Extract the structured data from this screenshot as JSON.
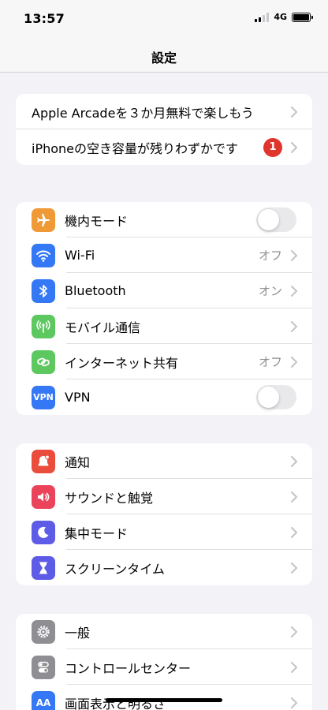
{
  "status_bar": {
    "time": "13:57",
    "network": "4G"
  },
  "nav": {
    "title": "設定"
  },
  "group1": [
    {
      "label": "Apple Arcadeを３か月無料で楽しもう"
    },
    {
      "label": "iPhoneの空き容量が残りわずかです",
      "badge": "1"
    }
  ],
  "group2": [
    {
      "label": "機内モード",
      "icon": "airplane-icon",
      "color": "#f09a37",
      "toggle": false
    },
    {
      "label": "Wi-Fi",
      "icon": "wifi-icon",
      "color": "#3478f6",
      "value": "オフ"
    },
    {
      "label": "Bluetooth",
      "icon": "bluetooth-icon",
      "color": "#3478f6",
      "value": "オン"
    },
    {
      "label": "モバイル通信",
      "icon": "antenna-icon",
      "color": "#5cc85f"
    },
    {
      "label": "インターネット共有",
      "icon": "link-icon",
      "color": "#5cc85f",
      "value": "オフ"
    },
    {
      "label": "VPN",
      "icon": "vpn-icon",
      "icon_text": "VPN",
      "color": "#3478f6",
      "toggle": false
    }
  ],
  "group3": [
    {
      "label": "通知",
      "icon": "bell-icon",
      "color": "#eb4d3d"
    },
    {
      "label": "サウンドと触覚",
      "icon": "speaker-icon",
      "color": "#eb445a"
    },
    {
      "label": "集中モード",
      "icon": "moon-icon",
      "color": "#5e5ce6"
    },
    {
      "label": "スクリーンタイム",
      "icon": "hourglass-icon",
      "color": "#5e5ce6"
    }
  ],
  "group4": [
    {
      "label": "一般",
      "icon": "gear-icon",
      "color": "#8e8e93"
    },
    {
      "label": "コントロールセンター",
      "icon": "switches-icon",
      "color": "#8e8e93"
    },
    {
      "label": "画面表示と明るさ",
      "icon": "text-size-icon",
      "icon_text": "AA",
      "color": "#3478f6"
    }
  ]
}
